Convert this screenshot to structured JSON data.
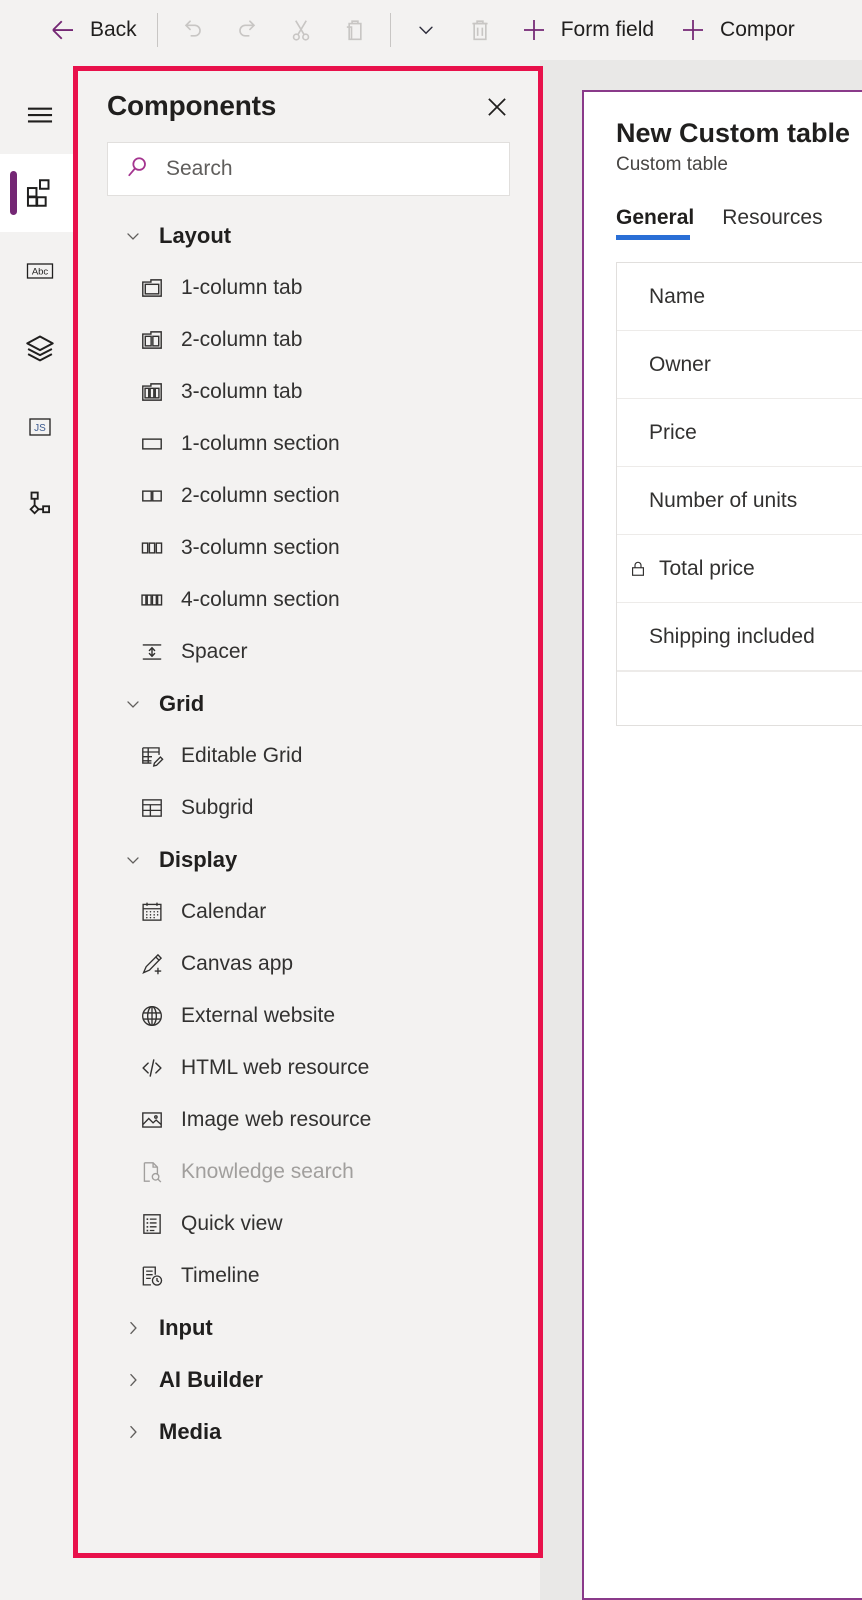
{
  "commandbar": {
    "back_label": "Back",
    "items": [
      {
        "name": "back",
        "icon": "arrow-left-icon",
        "label": "Back",
        "disabled": false
      },
      {
        "name": "undo",
        "icon": "undo-icon",
        "label": "",
        "disabled": true
      },
      {
        "name": "redo",
        "icon": "redo-icon",
        "label": "",
        "disabled": true
      },
      {
        "name": "cut",
        "icon": "scissors-icon",
        "label": "",
        "disabled": true
      },
      {
        "name": "paste",
        "icon": "clipboard-icon",
        "label": "",
        "disabled": true
      },
      {
        "name": "paste-more",
        "icon": "chevron-down-icon",
        "label": "",
        "disabled": true
      },
      {
        "name": "delete",
        "icon": "trash-icon",
        "label": "",
        "disabled": true
      },
      {
        "name": "form-field",
        "icon": "plus-icon",
        "label": "Form field",
        "disabled": false
      },
      {
        "name": "component",
        "icon": "plus-icon",
        "label": "Compor",
        "disabled": false
      }
    ],
    "form_field_label": "Form field",
    "component_label": "Compor"
  },
  "rail": {
    "items": [
      {
        "name": "menu",
        "icon": "hamburger-icon",
        "active": false
      },
      {
        "name": "components",
        "icon": "components-icon",
        "active": true
      },
      {
        "name": "properties",
        "icon": "abc-icon",
        "active": false
      },
      {
        "name": "layers",
        "icon": "layers-icon",
        "active": false
      },
      {
        "name": "javascript",
        "icon": "js-icon",
        "active": false
      },
      {
        "name": "business-rules",
        "icon": "flow-icon",
        "active": false
      }
    ]
  },
  "panel": {
    "title": "Components",
    "close_label": "Close",
    "search": {
      "value": "",
      "placeholder": "Search"
    },
    "groups": [
      {
        "name": "Layout",
        "expanded": true,
        "items": [
          {
            "label": "1-column tab",
            "icon": "one-column-tab-icon",
            "disabled": false
          },
          {
            "label": "2-column tab",
            "icon": "two-column-tab-icon",
            "disabled": false
          },
          {
            "label": "3-column tab",
            "icon": "three-column-tab-icon",
            "disabled": false
          },
          {
            "label": "1-column section",
            "icon": "one-column-section-icon",
            "disabled": false
          },
          {
            "label": "2-column section",
            "icon": "two-column-section-icon",
            "disabled": false
          },
          {
            "label": "3-column section",
            "icon": "three-column-section-icon",
            "disabled": false
          },
          {
            "label": "4-column section",
            "icon": "four-column-section-icon",
            "disabled": false
          },
          {
            "label": "Spacer",
            "icon": "spacer-icon",
            "disabled": false
          }
        ]
      },
      {
        "name": "Grid",
        "expanded": true,
        "items": [
          {
            "label": "Editable Grid",
            "icon": "editable-grid-icon",
            "disabled": false
          },
          {
            "label": "Subgrid",
            "icon": "subgrid-icon",
            "disabled": false
          }
        ]
      },
      {
        "name": "Display",
        "expanded": true,
        "items": [
          {
            "label": "Calendar",
            "icon": "calendar-icon",
            "disabled": false
          },
          {
            "label": "Canvas app",
            "icon": "canvas-app-icon",
            "disabled": false
          },
          {
            "label": "External website",
            "icon": "globe-icon",
            "disabled": false
          },
          {
            "label": "HTML web resource",
            "icon": "code-icon",
            "disabled": false
          },
          {
            "label": "Image web resource",
            "icon": "image-icon",
            "disabled": false
          },
          {
            "label": "Knowledge search",
            "icon": "knowledge-search-icon",
            "disabled": true
          },
          {
            "label": "Quick view",
            "icon": "quick-view-icon",
            "disabled": false
          },
          {
            "label": "Timeline",
            "icon": "timeline-icon",
            "disabled": false
          }
        ]
      },
      {
        "name": "Input",
        "expanded": false,
        "items": []
      },
      {
        "name": "AI Builder",
        "expanded": false,
        "items": []
      },
      {
        "name": "Media",
        "expanded": false,
        "items": []
      }
    ]
  },
  "form": {
    "title": "New Custom table",
    "subtitle": "Custom table",
    "tabs": [
      {
        "label": "General",
        "active": true
      },
      {
        "label": "Resources",
        "active": false
      }
    ],
    "fields": [
      {
        "label": "Name",
        "locked": false
      },
      {
        "label": "Owner",
        "locked": false
      },
      {
        "label": "Price",
        "locked": false
      },
      {
        "label": "Number of units",
        "locked": false
      },
      {
        "label": "Total price",
        "locked": true
      },
      {
        "label": "Shipping included",
        "locked": false
      }
    ]
  },
  "annotation": {
    "highlight_color": "#e8114b",
    "target": "components-panel"
  },
  "colors": {
    "accent_purple": "#742774",
    "tab_underline_blue": "#2a6fd6",
    "form_border_purple": "#8a3a8a",
    "panel_bg": "#f3f2f1",
    "canvas_bg": "#e9e8e7"
  }
}
